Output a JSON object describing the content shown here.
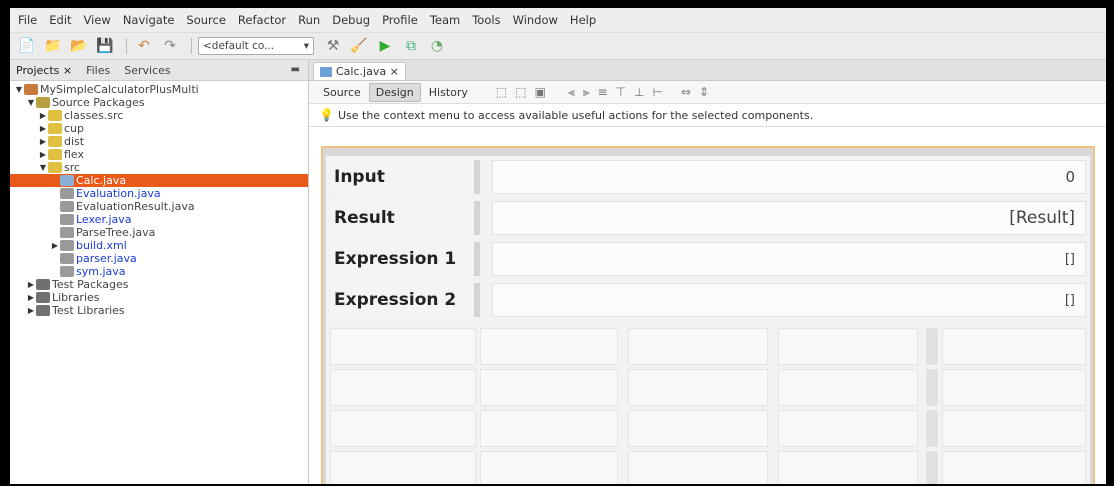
{
  "menu": [
    "File",
    "Edit",
    "View",
    "Navigate",
    "Source",
    "Refactor",
    "Run",
    "Debug",
    "Profile",
    "Team",
    "Tools",
    "Window",
    "Help"
  ],
  "toolbar": {
    "config_value": "<default co..."
  },
  "projects_panel": {
    "tabs": [
      "Projects ×",
      "Files",
      "Services"
    ],
    "tree": [
      {
        "label": "MySimpleCalculatorPlusMulti",
        "indent": 0,
        "exp": "▼",
        "icon": "project-icon",
        "color": "#c87a3a"
      },
      {
        "label": "Source Packages",
        "indent": 1,
        "exp": "▼",
        "icon": "source-packages-icon",
        "color": "#b8a040"
      },
      {
        "label": "classes.src",
        "indent": 2,
        "exp": "▶",
        "icon": "package-icon",
        "color": "#e0c040"
      },
      {
        "label": "cup",
        "indent": 2,
        "exp": "▶",
        "icon": "package-icon",
        "color": "#e0c040"
      },
      {
        "label": "dist",
        "indent": 2,
        "exp": "▶",
        "icon": "package-icon",
        "color": "#e0c040"
      },
      {
        "label": "flex",
        "indent": 2,
        "exp": "▶",
        "icon": "package-icon",
        "color": "#e0c040"
      },
      {
        "label": "src",
        "indent": 2,
        "exp": "▼",
        "icon": "package-icon",
        "color": "#e0c040"
      },
      {
        "label": "Calc.java",
        "indent": 3,
        "exp": "",
        "icon": "java-form-icon",
        "color": "#8ab0d8",
        "selected": true
      },
      {
        "label": "Evaluation.java",
        "indent": 3,
        "exp": "",
        "icon": "java-file-icon",
        "color": "#9a9a9a",
        "blue": true
      },
      {
        "label": "EvaluationResult.java",
        "indent": 3,
        "exp": "",
        "icon": "java-file-icon",
        "color": "#9a9a9a"
      },
      {
        "label": "Lexer.java",
        "indent": 3,
        "exp": "",
        "icon": "java-file-icon",
        "color": "#9a9a9a",
        "blue": true
      },
      {
        "label": "ParseTree.java",
        "indent": 3,
        "exp": "",
        "icon": "java-file-icon",
        "color": "#9a9a9a"
      },
      {
        "label": "build.xml",
        "indent": 3,
        "exp": "▶",
        "icon": "xml-file-icon",
        "color": "#9a9a9a",
        "blue": true
      },
      {
        "label": "parser.java",
        "indent": 3,
        "exp": "",
        "icon": "java-file-icon",
        "color": "#9a9a9a",
        "blue": true
      },
      {
        "label": "sym.java",
        "indent": 3,
        "exp": "",
        "icon": "java-file-icon",
        "color": "#9a9a9a",
        "blue": true
      },
      {
        "label": "Test Packages",
        "indent": 1,
        "exp": "▶",
        "icon": "test-packages-icon",
        "color": "#707070"
      },
      {
        "label": "Libraries",
        "indent": 1,
        "exp": "▶",
        "icon": "libraries-icon",
        "color": "#707070"
      },
      {
        "label": "Test Libraries",
        "indent": 1,
        "exp": "▶",
        "icon": "test-libraries-icon",
        "color": "#707070"
      }
    ]
  },
  "editor": {
    "tab_label": "Calc.java ×",
    "views": [
      "Source",
      "Design",
      "History"
    ],
    "hint": "Use the context menu to access available useful actions for the selected components."
  },
  "form": {
    "rows": [
      {
        "label": "Input",
        "value": "0",
        "font": 15
      },
      {
        "label": "Result",
        "value": "[Result]",
        "font": 17
      },
      {
        "label": "Expression 1",
        "value": "[]",
        "font": 13
      },
      {
        "label": "Expression 2",
        "value": "[]",
        "font": 13
      }
    ]
  },
  "colors": {
    "selection": "#e8591a",
    "link": "#1a3cd6",
    "canvas_border": "#f0c080"
  }
}
